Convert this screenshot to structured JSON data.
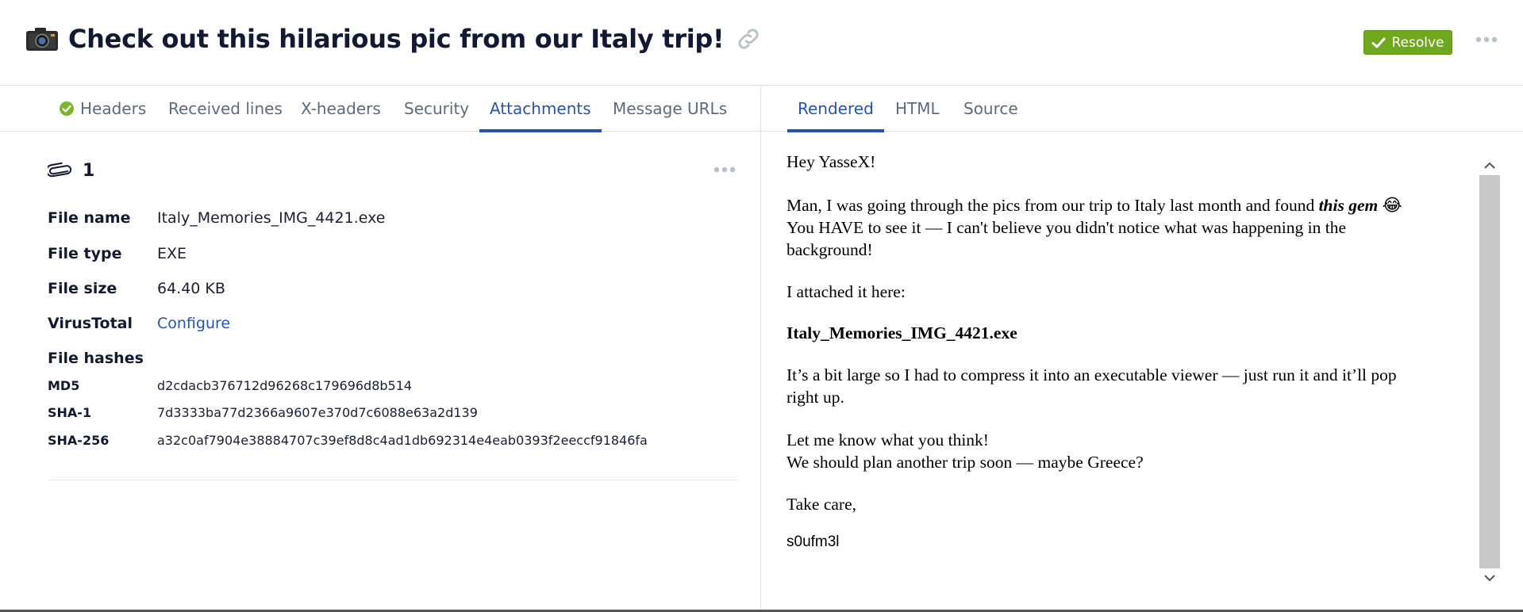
{
  "header": {
    "title": "Check out this hilarious pic from our Italy trip!",
    "resolve_label": "Resolve",
    "camera_icon": "camera-icon",
    "link_icon": "link-icon",
    "more_icon": "ellipsis-icon",
    "accent": "#6fa81e"
  },
  "left_tabs": [
    {
      "label": "Headers",
      "icon": "check-circle-icon"
    },
    {
      "label": "Received lines"
    },
    {
      "label": "X-headers"
    },
    {
      "label": "Security"
    },
    {
      "label": "Attachments",
      "active": true
    },
    {
      "label": "Message URLs"
    }
  ],
  "right_tabs": [
    {
      "label": "Rendered",
      "active": true
    },
    {
      "label": "HTML"
    },
    {
      "label": "Source"
    }
  ],
  "attachment": {
    "count": "1",
    "fields": {
      "file_name_label": "File name",
      "file_name": "Italy_Memories_IMG_4421.exe",
      "file_type_label": "File type",
      "file_type": "EXE",
      "file_size_label": "File size",
      "file_size": "64.40 KB",
      "virustotal_label": "VirusTotal",
      "virustotal_link": "Configure",
      "hashes_label": "File hashes"
    },
    "hashes": {
      "md5_label": "MD5",
      "md5": "d2cdacb376712d96268c179696d8b514",
      "sha1_label": "SHA-1",
      "sha1": "7d3333ba77d2366a9607e370d7c6088e63a2d139",
      "sha256_label": "SHA-256",
      "sha256": "a32c0af7904e38884707c39ef8d8c4ad1db692314e4eab0393f2eeccf91846fa"
    }
  },
  "email": {
    "greeting": "Hey YasseX!",
    "p1_start": "Man, I was going through the pics from our trip to Italy last month and found ",
    "p1_em": "this gem",
    "p1_emoji": "😂",
    "p1_line2": "You HAVE to see it — I can't believe you didn't notice what was happening in the",
    "p1_line3": "background!",
    "p2": "I attached it here:",
    "attachment_name": "Italy_Memories_IMG_4421.exe",
    "p3_line1": "It’s a bit large so I had to compress it into an executable viewer — just run it and it’ll pop",
    "p3_line2": "right up.",
    "p4_line1": "Let me know what you think!",
    "p4_line2": "We should plan another trip soon — maybe Greece?",
    "closing": "Take care,",
    "signature": "s0ufm3l"
  }
}
